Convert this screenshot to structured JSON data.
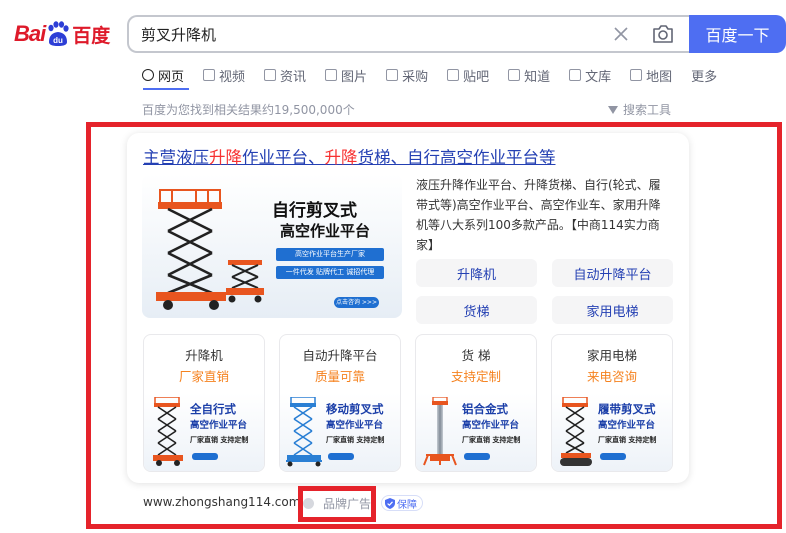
{
  "logo": {
    "text_latin": "Bai",
    "text_paw": "du",
    "text_zh": "百度"
  },
  "search": {
    "query": "剪叉升降机",
    "button_label": "百度一下"
  },
  "tabs": [
    {
      "label": "网页",
      "active": true,
      "icon": "search-icon"
    },
    {
      "label": "视频",
      "icon": "video-icon"
    },
    {
      "label": "资讯",
      "icon": "news-icon"
    },
    {
      "label": "图片",
      "icon": "image-icon"
    },
    {
      "label": "采购",
      "icon": "purchase-icon"
    },
    {
      "label": "贴吧",
      "icon": "tieba-icon"
    },
    {
      "label": "知道",
      "icon": "question-icon"
    },
    {
      "label": "文库",
      "icon": "document-icon"
    },
    {
      "label": "地图",
      "icon": "map-icon"
    },
    {
      "label": "更多"
    }
  ],
  "result_count": "百度为您找到相关结果约19,500,000个",
  "tools_label": "搜索工具",
  "ad": {
    "title_parts": [
      "主营液压",
      "升降",
      "作业平台、",
      "升降",
      "货梯、自行高空作业平台等"
    ],
    "banner": {
      "title1": "自行剪叉式",
      "title2": "高空作业平台",
      "tag1": "高空作业平台生产厂家",
      "tag2": "一件代发  贴牌代工  诚招代理",
      "button": "点击咨询 >>>"
    },
    "description": "液压升降作业平台、升降货梯、自行(轮式、履带式等)高空作业平台、高空作业车、家用升降机等八大系列100多款产品。【中商114实力商家】",
    "keywords": [
      "升降机",
      "自动升降平台",
      "货梯",
      "家用电梯"
    ],
    "products": [
      {
        "name": "升降机",
        "sub": "厂家直销",
        "t1": "全自行式",
        "t2": "高空作业平台",
        "tag": "厂家直销 支持定制"
      },
      {
        "name": "自动升降平台",
        "sub": "质量可靠",
        "t1": "移动剪叉式",
        "t2": "高空作业平台",
        "tag": "厂家直销 支持定制"
      },
      {
        "name": "货 梯",
        "sub": "支持定制",
        "t1": "铝合金式",
        "t2": "高空作业平台",
        "tag": "厂家直销 支持定制"
      },
      {
        "name": "家用电梯",
        "sub": "来电咨询",
        "t1": "履带剪叉式",
        "t2": "高空作业平台",
        "tag": "厂家直销 支持定制"
      }
    ],
    "footer": {
      "url": "www.zhongshang114.com",
      "brand_label": "品牌广告",
      "guarantee": "保障"
    }
  },
  "colors": {
    "accent": "#4e6ef2",
    "link": "#2440b3",
    "highlight": "#f73131",
    "annotation": "#e5232b",
    "orange": "#f5821f"
  }
}
